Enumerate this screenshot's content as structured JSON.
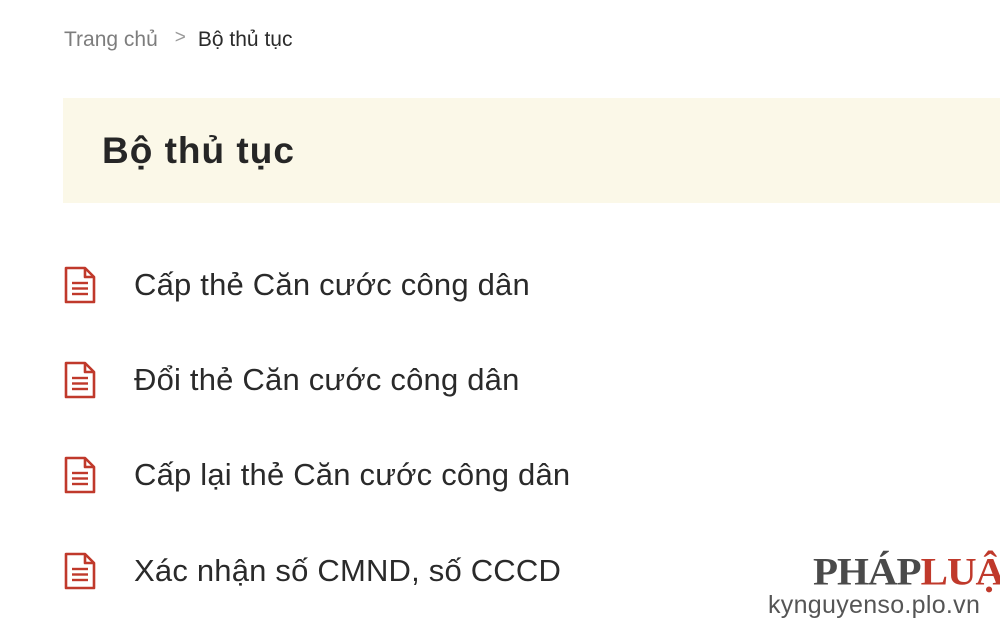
{
  "breadcrumb": {
    "home": "Trang chủ",
    "separator": ">",
    "current": "Bộ thủ tục"
  },
  "page_title": "Bộ thủ tục",
  "procedures": [
    {
      "label": "Cấp thẻ Căn cước công dân",
      "icon": "document-icon"
    },
    {
      "label": "Đổi thẻ Căn cước công dân",
      "icon": "document-icon"
    },
    {
      "label": "Cấp lại thẻ Căn cước công dân",
      "icon": "document-icon"
    },
    {
      "label": "Xác nhận số CMND, số CCCD",
      "icon": "document-icon"
    }
  ],
  "watermark": {
    "logo_part1": "PHÁP",
    "logo_part2": "LUẬT",
    "site": "kynguyenso.plo.vn"
  },
  "colors": {
    "banner_bg": "#fbf8e8",
    "icon_red": "#c0392b",
    "text": "#2a2a2a",
    "muted": "#7d7d7d"
  }
}
